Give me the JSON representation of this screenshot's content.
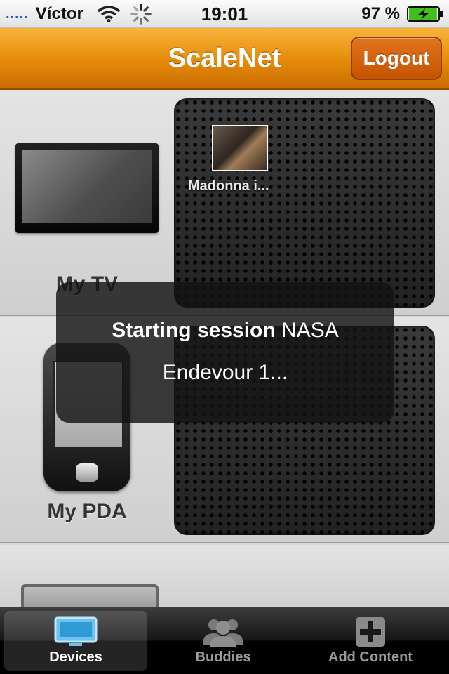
{
  "status_bar": {
    "carrier": "Víctor",
    "signal_icon": "signal-bars-icon",
    "time": "19:01",
    "battery_percent": "97 %",
    "battery_level": 0.97
  },
  "nav": {
    "title": "ScaleNet",
    "logout_label": "Logout",
    "accent": "#e48a08"
  },
  "devices": [
    {
      "label": "My TV",
      "icon": "tv-icon",
      "content": [
        {
          "label": "Madonna i...",
          "icon": "video-thumbnail"
        }
      ]
    },
    {
      "label": "My PDA",
      "icon": "pda-icon",
      "content": []
    },
    {
      "label": "",
      "icon": "monitor-icon",
      "content": []
    }
  ],
  "hud": {
    "line1_bold": "Starting session",
    "line1_rest": " NASA",
    "line2": "Endevour 1..."
  },
  "tabs": [
    {
      "label": "Devices",
      "icon": "tv-icon",
      "active": true
    },
    {
      "label": "Buddies",
      "icon": "buddies-icon",
      "active": false
    },
    {
      "label": "Add Content",
      "icon": "add-icon",
      "active": false
    }
  ]
}
